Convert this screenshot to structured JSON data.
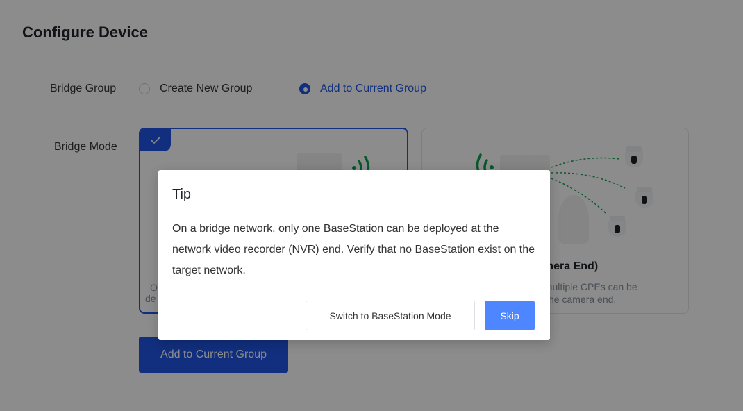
{
  "page": {
    "title": "Configure Device"
  },
  "bridge_group": {
    "label": "Bridge Group",
    "options": [
      {
        "label": "Create New Group",
        "selected": false
      },
      {
        "label": "Add to Current Group",
        "selected": true
      }
    ]
  },
  "bridge_mode": {
    "label": "Bridge Mode",
    "cards": [
      {
        "selected": true,
        "title": "",
        "desc_line1": "O",
        "desc_line2": "de"
      },
      {
        "selected": false,
        "title": "amera End)",
        "desc_line1": ", multiple CPEs can be",
        "desc_line2": "he camera end."
      }
    ]
  },
  "actions": {
    "primary_label": "Add to Current Group"
  },
  "dialog": {
    "title": "Tip",
    "body": "On a bridge network, only one BaseStation can be deployed at the network video recorder (NVR) end. Verify that no BaseStation exist on the target network.",
    "secondary_label": "Switch to BaseStation Mode",
    "primary_label": "Skip"
  },
  "colors": {
    "accent": "#1f56e6",
    "dialog_primary": "#4d86ff",
    "signal_green": "#12a150",
    "overlay": "rgba(0,0,0,0.45)"
  },
  "icons": {
    "check": "checkmark-icon",
    "signal": "wifi-signal-icon",
    "camera": "camera-icon"
  }
}
